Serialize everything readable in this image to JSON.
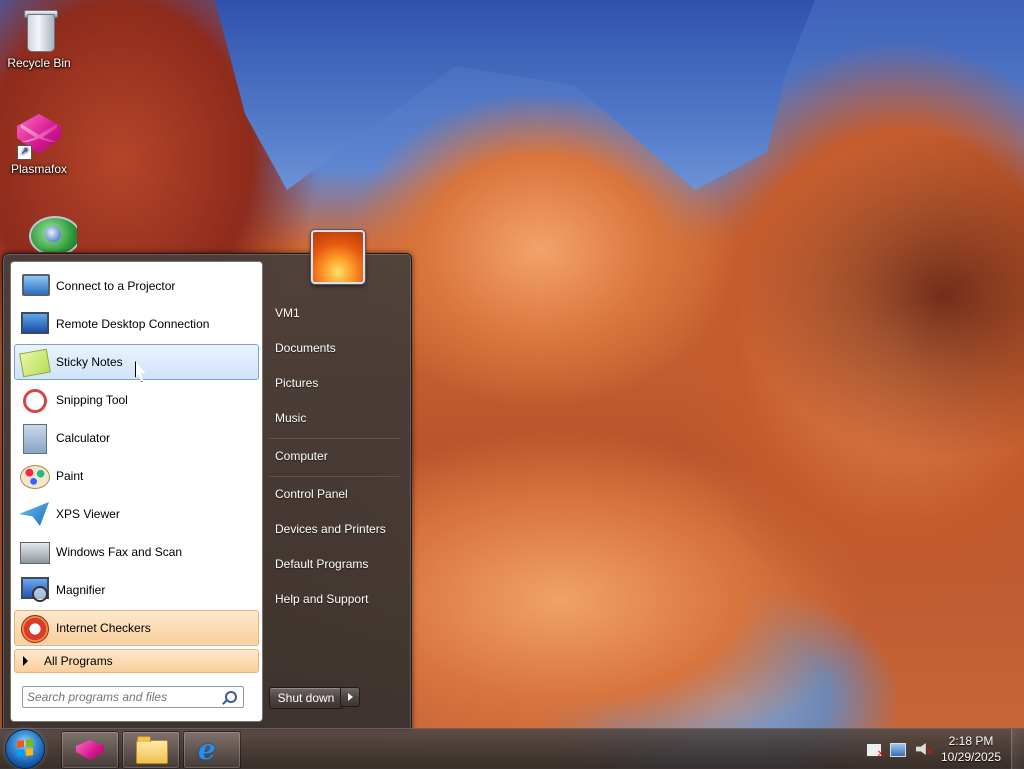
{
  "desktop": {
    "icons": [
      {
        "label": "Recycle Bin",
        "icon": "recycle-bin-icon"
      },
      {
        "label": "Plasmafox",
        "icon": "plasmafox-icon"
      },
      {
        "label": "",
        "icon": "browser-globe-icon"
      }
    ]
  },
  "start_menu": {
    "programs": [
      {
        "label": "Connect to a Projector",
        "icon": "projector-icon"
      },
      {
        "label": "Remote Desktop Connection",
        "icon": "remote-desktop-icon"
      },
      {
        "label": "Sticky Notes",
        "icon": "sticky-notes-icon",
        "state": "hover"
      },
      {
        "label": "Snipping Tool",
        "icon": "snipping-tool-icon"
      },
      {
        "label": "Calculator",
        "icon": "calculator-icon"
      },
      {
        "label": "Paint",
        "icon": "paint-icon"
      },
      {
        "label": "XPS Viewer",
        "icon": "xps-viewer-icon"
      },
      {
        "label": "Windows Fax and Scan",
        "icon": "fax-scan-icon"
      },
      {
        "label": "Magnifier",
        "icon": "magnifier-icon"
      },
      {
        "label": "Internet Checkers",
        "icon": "internet-checkers-icon",
        "state": "newly-installed"
      }
    ],
    "all_programs": "All Programs",
    "search_placeholder": "Search programs and files",
    "right": {
      "user": "VM1",
      "documents": "Documents",
      "pictures": "Pictures",
      "music": "Music",
      "computer": "Computer",
      "control_panel": "Control Panel",
      "devices": "Devices and Printers",
      "default_programs": "Default Programs",
      "help": "Help and Support"
    },
    "shutdown": "Shut down"
  },
  "taskbar": {
    "pinned": [
      "plasmafox-icon",
      "file-explorer-icon",
      "internet-explorer-icon"
    ],
    "ie_glyph": "e",
    "tray": [
      "action-center-flag-icon",
      "network-icon",
      "volume-muted-icon"
    ],
    "time": "2:18 PM",
    "date": "10/29/2025"
  },
  "colors": {
    "hover_blue": "#cfe3fa",
    "highlight_orange": "#f9cf9a",
    "taskbar": "#302a28"
  }
}
